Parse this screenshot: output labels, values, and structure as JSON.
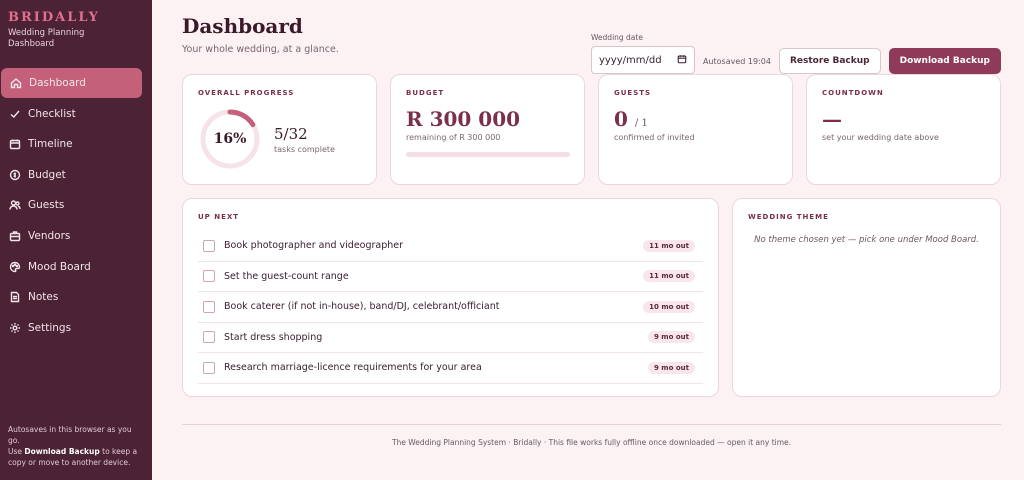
{
  "brand": {
    "name": "BRIDALLY",
    "subtitle": "Wedding Planning Dashboard"
  },
  "nav": [
    {
      "label": "Dashboard",
      "icon": "home-icon",
      "active": true
    },
    {
      "label": "Checklist",
      "icon": "check-icon"
    },
    {
      "label": "Timeline",
      "icon": "calendar-icon"
    },
    {
      "label": "Budget",
      "icon": "coin-icon"
    },
    {
      "label": "Guests",
      "icon": "users-icon"
    },
    {
      "label": "Vendors",
      "icon": "briefcase-icon"
    },
    {
      "label": "Mood Board",
      "icon": "palette-icon"
    },
    {
      "label": "Notes",
      "icon": "note-icon"
    },
    {
      "label": "Settings",
      "icon": "gear-icon"
    }
  ],
  "sidebar_footer": {
    "line1": "Autosaves in this browser as you go.",
    "pre": "Use ",
    "bold": "Download Backup",
    "post": " to keep a copy or move to another device."
  },
  "header": {
    "title": "Dashboard",
    "subtitle": "Your whole wedding, at a glance.",
    "date_label": "Wedding date",
    "date_placeholder": "yyyy/mm/dd",
    "autosave": "Autosaved 19:04",
    "restore": "Restore Backup",
    "download": "Download Backup"
  },
  "progress": {
    "title": "OVERALL PROGRESS",
    "percent_label": "16%",
    "percent": 16,
    "done": "5/32",
    "note": "tasks complete"
  },
  "budget": {
    "title": "BUDGET",
    "value": "R 300 000",
    "note": "remaining of R 300 000",
    "spent_fraction": 0
  },
  "guests": {
    "title": "GUESTS",
    "count": "0",
    "of": "/ 1",
    "note": "confirmed of invited"
  },
  "countdown": {
    "title": "COUNTDOWN",
    "value": "—",
    "note": "set your wedding date above"
  },
  "upnext": {
    "title": "UP NEXT",
    "tasks": [
      {
        "text": "Book photographer and videographer",
        "due": "11 mo out"
      },
      {
        "text": "Set the guest-count range",
        "due": "11 mo out"
      },
      {
        "text": "Book caterer (if not in-house), band/DJ, celebrant/officiant",
        "due": "10 mo out"
      },
      {
        "text": "Start dress shopping",
        "due": "9 mo out"
      },
      {
        "text": "Research marriage-licence requirements for your area",
        "due": "9 mo out"
      }
    ]
  },
  "theme": {
    "title": "WEDDING THEME",
    "text": "No theme chosen yet — pick one under Mood Board."
  },
  "footer": {
    "text": "The Wedding Planning System · Bridally · This file works fully offline once downloaded — open it any time."
  },
  "colors": {
    "sidebar": "#4c2235",
    "accent": "#c4607a",
    "primary": "#8e3a58",
    "background": "#fcf2f4"
  }
}
